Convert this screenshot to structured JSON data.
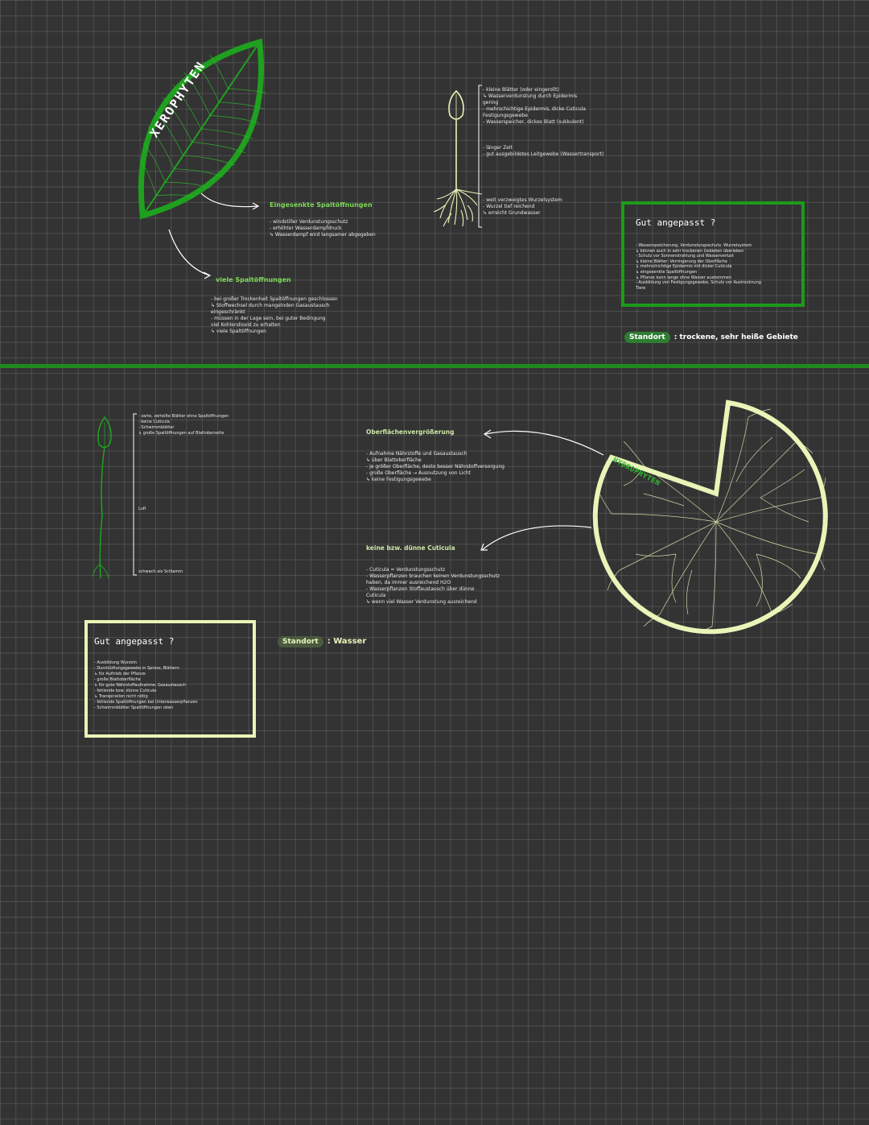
{
  "colors": {
    "background": "#333333",
    "grid": "#4a4a4a",
    "xero_green": "#22a022",
    "hydro_pale": "#e8f5b8",
    "accent_green": "#7ed957"
  },
  "xerophyten": {
    "leaf_title": "XEROPHYTEN",
    "branch1": {
      "heading": "Eingesenkte Spaltöffnungen",
      "lines": [
        "- windstiller Verdunstungsschutz",
        "- erhöhter Wasserdampfdruck",
        "↳ Wasserdampf wird langsamer abgegeben"
      ]
    },
    "branch2": {
      "heading": "viele Spaltöffnungen",
      "lines": [
        "- bei großer Trockenheit Spaltöffnungen geschlossen",
        "↳ Stoffwechsel durch mangelnden Gasaustausch",
        "eingeschränkt",
        "- müssen in der Lage sein, bei guter Bedingung",
        "viel Kohlendioxid zu erhalten",
        "↳ viele Spaltöffnungen"
      ]
    },
    "plant_notes_top": [
      "- kleine Blätter (oder eingerollt)",
      "↳ Wasserverdunstung durch Epidermis",
      "gering",
      "- mehrschichtige Epidermis, dicke Cuticula",
      "Festigungsgewebe",
      "- Wasserspeicher, dickes Blatt (sukkulent)"
    ],
    "plant_notes_mid": [
      "- länger Zeit",
      "- gut ausgebildetes Leitgewebe (Wassertransport)"
    ],
    "plant_notes_bottom": [
      "- weit verzweigtes Wurzelsystem",
      "- Wurzel tief reichend",
      "↳ erreicht Grundwasser"
    ],
    "box": {
      "title": "Gut angepasst ?",
      "lines": [
        "- Wasserspeicherung, Verdunstungsschutz, Wurzelsystem",
        "↳ können auch in sehr trockenen Gebieten überleben",
        "- Schutz vor Sonnenstrahlung und Wasserverlust",
        "↳ kleine Blätter: Verringerung der Oberfläche",
        "↳ mehrschichtige Epidermis mit dicker Cuticula",
        "↳ eingesenkte Spaltöffnungen",
        "↳ Pflanze kann lange ohne Wasser auskommen",
        "- Ausbildung von Festigungsgewebe, Schutz vor Austrocknung",
        "Tiere"
      ]
    },
    "standort_label": "Standort",
    "standort_value": ": trockene, sehr heiße Gebiete"
  },
  "hydrophyten": {
    "leaf_title": "HYDROPHYTEN",
    "plant_notes_top": [
      "- zarte, zerteilte Blätter ohne Spaltöffnungen",
      "- keine Cuticula",
      "- Schwimmblätter",
      "↳ große Spaltöffnungen auf Blattoberseite"
    ],
    "plant_notes_mid": [
      "Luft"
    ],
    "plant_notes_bottom": [
      "schwach als Schlamm"
    ],
    "branch1": {
      "heading": "Oberflächenvergrößerung",
      "lines": [
        "- Aufnahme Nährstoffe und Gasaustausch",
        "↳ über Blattoberfläche",
        "- je größer Oberfläche, desto besser Nährstoffversorgung",
        "- große Oberfläche → Ausnutzung von Licht",
        "↳ keine Festigungsgewebe"
      ]
    },
    "branch2": {
      "heading": "keine bzw. dünne Cuticula",
      "lines": [
        "- Cuticula = Verdunstungsschutz",
        "- Wasserpflanzen brauchen keinen Verdunstungsschutz",
        "haben, da immer ausreichend H2O",
        "- Wasserpflanzen Stoffaustausch über dünne",
        "Cuticula",
        "↳ wenn viel Wasser Verdunstung ausreichend"
      ]
    },
    "box": {
      "title": "Gut angepasst ?",
      "lines": [
        "- Ausbildung Wurzeln",
        "- Durchlüftungsgewebe in Spross, Blättern",
        "↳ für Auftrieb der Pflanze",
        "- große Blattoberfläche",
        "↳ für gute Nährstoffaufnahme, Gasaustausch",
        "- fehlende bzw. dünne Cuticula",
        "↳ Transpiration nicht nötig",
        "- fehlende Spaltöffnungen bei Unterwasserpflanzen",
        "- Schwimmblätter Spaltöffnungen oben"
      ]
    },
    "standort_label": "Standort",
    "standort_value": ": Wasser"
  }
}
